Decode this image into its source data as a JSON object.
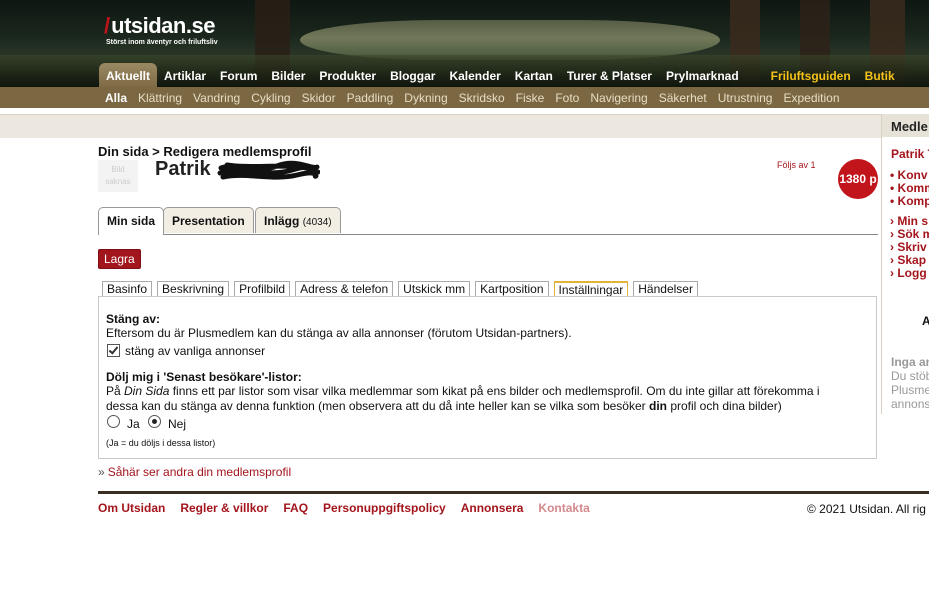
{
  "site": {
    "logo_text": "utsidan.se",
    "tagline": "Störst inom äventyr och friluftsliv"
  },
  "main_nav": [
    {
      "label": "Aktuellt",
      "active": true
    },
    {
      "label": "Artiklar"
    },
    {
      "label": "Forum"
    },
    {
      "label": "Bilder"
    },
    {
      "label": "Produkter"
    },
    {
      "label": "Bloggar"
    },
    {
      "label": "Kalender"
    },
    {
      "label": "Kartan"
    },
    {
      "label": "Turer & Platser"
    },
    {
      "label": "Prylmarknad"
    },
    {
      "label": "Friluftsguiden",
      "highlight": true
    },
    {
      "label": "Butik",
      "highlight": true
    }
  ],
  "sub_nav": [
    {
      "label": "Alla",
      "active": true
    },
    {
      "label": "Klättring"
    },
    {
      "label": "Vandring"
    },
    {
      "label": "Cykling"
    },
    {
      "label": "Skidor"
    },
    {
      "label": "Paddling"
    },
    {
      "label": "Dykning"
    },
    {
      "label": "Skridsko"
    },
    {
      "label": "Fiske"
    },
    {
      "label": "Foto"
    },
    {
      "label": "Navigering"
    },
    {
      "label": "Säkerhet"
    },
    {
      "label": "Utrustning"
    },
    {
      "label": "Expedition"
    }
  ],
  "breadcrumb": "Din sida > Redigera medlemsprofil",
  "profile": {
    "avatar_text": "Bild saknas",
    "name": "Patrik",
    "follows": "Följs av 1",
    "points": "1380 p"
  },
  "profile_tabs": [
    {
      "label": "Min sida",
      "active": true
    },
    {
      "label": "Presentation"
    },
    {
      "label": "Inlägg",
      "count": "(4034)"
    }
  ],
  "save_label": "Lagra",
  "settings_tabs": [
    {
      "label": "Basinfo"
    },
    {
      "label": "Beskrivning"
    },
    {
      "label": "Profilbild"
    },
    {
      "label": "Adress & telefon"
    },
    {
      "label": "Utskick mm"
    },
    {
      "label": "Kartposition"
    },
    {
      "label": "Inställningar",
      "active": true
    },
    {
      "label": "Händelser"
    }
  ],
  "settings": {
    "ads_heading": "Stäng av:",
    "ads_text": "Eftersom du är Plusmedlem kan du stänga av alla annonser (förutom Utsidan-partners).",
    "ads_checkbox_label": "stäng av vanliga annonser",
    "ads_checked": true,
    "visitors_heading": "Dölj mig i 'Senast besökare'-listor:",
    "visitors_text_1a": "På ",
    "visitors_text_1b": "Din Sida",
    "visitors_text_1c": " finns ett par listor som visar vilka medlemmar som kikat på ens bilder och medlemsprofil. Om du inte gillar att förekomma i",
    "visitors_text_2a": "dessa kan du stänga av denna funktion (men observera att du då inte heller kan se vilka som besöker ",
    "visitors_text_2b": "din",
    "visitors_text_2c": " profil och dina bilder)",
    "radio_yes": "Ja",
    "radio_no": "Nej",
    "selected": "Nej",
    "note": "(Ja = du döljs i dessa listor)"
  },
  "see_profile_link": "Såhär ser andra din medlemsprofil",
  "right_column": {
    "header": "Medle",
    "name": "Patrik T",
    "bullets": [
      "Konv",
      "Komm",
      "Komp"
    ],
    "links": [
      "Min s",
      "Sök m",
      "Skriv",
      "Skap",
      "Logg"
    ],
    "bold_letter": "A",
    "grey_heading": "Inga an",
    "grey_lines": [
      "Du stöb",
      "Plusme",
      "annons"
    ]
  },
  "footer": {
    "links": [
      "Om Utsidan",
      "Regler & villkor",
      "FAQ",
      "Personuppgiftspolicy",
      "Annonsera",
      "Kontakta"
    ],
    "copyright": "© 2021 Utsidan. All rig"
  },
  "colors": {
    "brand_red": "#a3151c",
    "nav_gold": "#f4c21a",
    "subnav_bg": "#7b6843"
  }
}
